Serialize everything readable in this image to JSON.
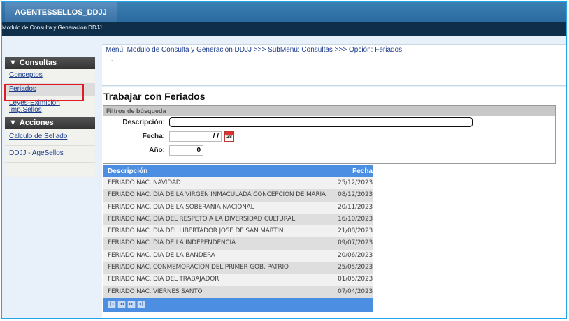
{
  "header": {
    "app_tab": "AGENTESSELLOS_DDJJ",
    "module_title": "Modulo de Consulta y Generacion DDJJ"
  },
  "sidebar": {
    "sections": [
      {
        "title": "Consultas",
        "items": [
          "Conceptos",
          "Feriados",
          "Leyes-Eximición Imp.Sellos"
        ]
      },
      {
        "title": "Acciones",
        "items": [
          "Calculo de Sellado",
          "DDJJ - AgeSellos"
        ]
      }
    ],
    "selected_item": "Feriados"
  },
  "breadcrumb": "Menú: Modulo de Consulta y Generacion DDJJ >>> SubMenú: Consultas >>> Opción: Feriados",
  "breadcrumb_extra": "-",
  "page_title": "Trabajar con Feriados",
  "filters": {
    "title": "Filtros de búsqueda",
    "descripcion_label": "Descripción:",
    "descripcion_value": "",
    "fecha_label": "Fecha:",
    "fecha_value": "/ /",
    "calendar_day": "28",
    "anio_label": "Año:",
    "anio_value": "0"
  },
  "grid": {
    "columns": [
      "Descripción",
      "Fecha"
    ],
    "rows": [
      {
        "descripcion": "FERIADO NAC. NAVIDAD",
        "fecha": "25/12/2023"
      },
      {
        "descripcion": "FERIADO NAC. DIA DE LA VIRGEN INMACULADA CONCEPCION DE MARIA",
        "fecha": "08/12/2023"
      },
      {
        "descripcion": "FERIADO NAC. DIA DE LA SOBERANIA NACIONAL",
        "fecha": "20/11/2023"
      },
      {
        "descripcion": "FERIADO NAC. DIA DEL RESPETO A LA DIVERSIDAD CULTURAL",
        "fecha": "16/10/2023"
      },
      {
        "descripcion": "FERIADO NAC. DIA DEL LIBERTADOR JOSE DE SAN MARTIN",
        "fecha": "21/08/2023"
      },
      {
        "descripcion": "FERIADO NAC. DIA DE LA INDEPENDENCIA",
        "fecha": "09/07/2023"
      },
      {
        "descripcion": "FERIADO NAC. DIA DE LA BANDERA",
        "fecha": "20/06/2023"
      },
      {
        "descripcion": "FERIADO NAC. CONMEMORACION DEL PRIMER GOB. PATRIO",
        "fecha": "25/05/2023"
      },
      {
        "descripcion": "FERIADO NAC. DIA DEL TRABAJADOR",
        "fecha": "01/05/2023"
      },
      {
        "descripcion": "FERIADO NAC. VIERNES SANTO",
        "fecha": "07/04/2023"
      }
    ],
    "pager_icons": [
      "first-page-icon",
      "previous-page-icon",
      "next-page-icon",
      "last-page-icon"
    ]
  },
  "colors": {
    "frame_border": "#20a6e8",
    "grid_header": "#4c8fe2",
    "selection_highlight": "#e01b24",
    "link": "#1b3c8c"
  }
}
